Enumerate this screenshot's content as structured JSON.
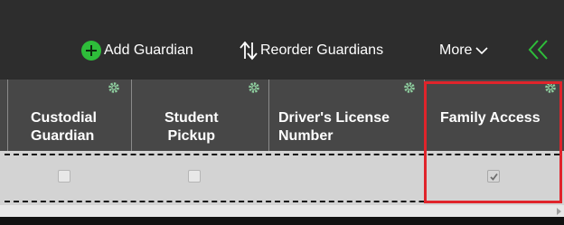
{
  "toolbar": {
    "add_label": "Add Guardian",
    "reorder_label": "Reorder Guardians",
    "more_label": "More"
  },
  "columns": [
    {
      "title_line1": "Custodial",
      "title_line2": "Guardian",
      "checked": false
    },
    {
      "title_line1": "Student",
      "title_line2": "Pickup",
      "checked": false
    },
    {
      "title_line1": "Driver's License",
      "title_line2": "Number"
    },
    {
      "title_line1": "Family Access",
      "title_line2": "",
      "checked": true
    }
  ],
  "colors": {
    "toolbar_bg": "#2d2d2d",
    "header_bg": "#474747",
    "row_bg": "#d3d3d3",
    "add_icon": "#2ebd3a",
    "gear": "#8fd0a0",
    "highlight": "#e0242b"
  },
  "icons": [
    "add-circle-icon",
    "reorder-arrows-icon",
    "chevron-down-icon",
    "double-chevron-left-icon",
    "gear-icon",
    "checkmark-icon"
  ]
}
